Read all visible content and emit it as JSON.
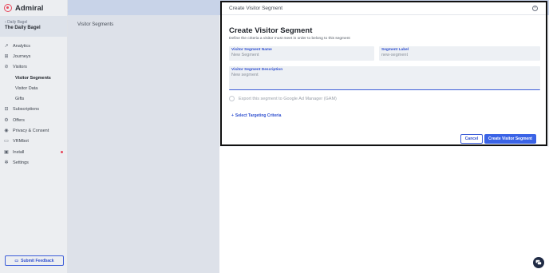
{
  "brand": {
    "name": "Admiral",
    "logo_icon": "admiral-logo-icon"
  },
  "publisher": {
    "sub_label": "Daily Bagel",
    "name": "The Daily Bagel"
  },
  "sidebar": {
    "items": [
      {
        "label": "Analytics",
        "icon": "analytics-icon"
      },
      {
        "label": "Journeys",
        "icon": "journeys-icon"
      },
      {
        "label": "Visitors",
        "icon": "visitors-icon"
      }
    ],
    "subitems": [
      {
        "label": "Visitor Segments",
        "active": true
      },
      {
        "label": "Visitor Data",
        "active": false
      },
      {
        "label": "Gifts",
        "active": false
      }
    ],
    "items2": [
      {
        "label": "Subscriptions",
        "icon": "subscriptions-icon"
      },
      {
        "label": "Offers",
        "icon": "offers-icon"
      },
      {
        "label": "Privacy & Consent",
        "icon": "privacy-icon"
      },
      {
        "label": "VRMbot",
        "icon": "vrmbot-icon"
      },
      {
        "label": "Install",
        "icon": "install-icon"
      },
      {
        "label": "Settings",
        "icon": "settings-icon"
      }
    ],
    "feedback_label": "Submit Feedback"
  },
  "main": {
    "title": "Visitor Segments"
  },
  "modal": {
    "header": "Create Visitor Segment",
    "title": "Create Visitor Segment",
    "description": "Define the criteria a visitor must meet in order to belong to this segment",
    "name_field": {
      "label": "Visitor Segment Name",
      "value": "New Segment"
    },
    "label_field": {
      "label": "Segment Label",
      "value": "new-segment"
    },
    "desc_field": {
      "label": "Visitor Segment Description",
      "value": "New segment"
    },
    "export_label": "Export this segment to Google Ad Manager (GAM)",
    "targeting_label": "Select Targeting Criteria",
    "cancel_label": "Cancel",
    "create_label": "Create Visitor Segment"
  },
  "colors": {
    "accent": "#3a63e6",
    "brand": "#e8485c",
    "topbar": "#c8d3e8"
  }
}
